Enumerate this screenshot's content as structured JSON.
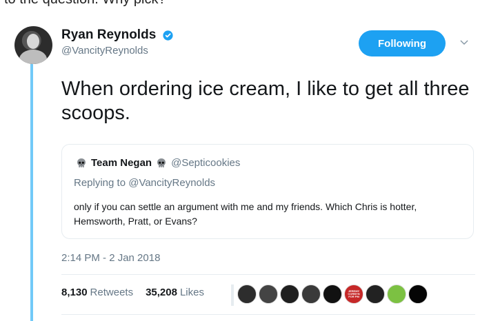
{
  "context": {
    "top_text": "to the question. Why pick?"
  },
  "tweet": {
    "author": {
      "display_name": "Ryan Reynolds",
      "handle": "@VancityReynolds",
      "verified": true
    },
    "follow_button_label": "Following",
    "text": "When ordering ice cream, I like to get all three scoops.",
    "timestamp": "2:14 PM - 2 Jan 2018",
    "stats": {
      "retweets_count": "8,130",
      "retweets_label": "Retweets",
      "likes_count": "35,208",
      "likes_label": "Likes"
    }
  },
  "quoted_tweet": {
    "display_name": "Team Negan",
    "handle": "@Septicookies",
    "replying_to": "Replying to @VancityReynolds",
    "text": "only if you can settle an argument with me and my friends. Which Chris is hotter, Hemsworth, Pratt, or Evans?"
  },
  "liker_avatars": [
    {
      "icon": "avatar-icon",
      "color": "#2d2d2d"
    },
    {
      "icon": "avatar-icon",
      "color": "#444444"
    },
    {
      "icon": "avatar-icon",
      "color": "#1f1f1f"
    },
    {
      "icon": "avatar-icon",
      "color": "#3a3a3a"
    },
    {
      "icon": "avatar-icon",
      "color": "#111111"
    },
    {
      "icon": "badge-avatar-icon",
      "color": "#c62828",
      "text": "JEREMY CORBYN FOR PM"
    },
    {
      "icon": "avatar-icon",
      "color": "#222222"
    },
    {
      "icon": "avatar-icon",
      "color": "#7cc142"
    },
    {
      "icon": "avatar-icon",
      "color": "#050505"
    }
  ],
  "colors": {
    "accent": "#1da1f2",
    "thread_line": "#71c9f8",
    "secondary_text": "#657786",
    "divider": "#e6ecf0"
  }
}
